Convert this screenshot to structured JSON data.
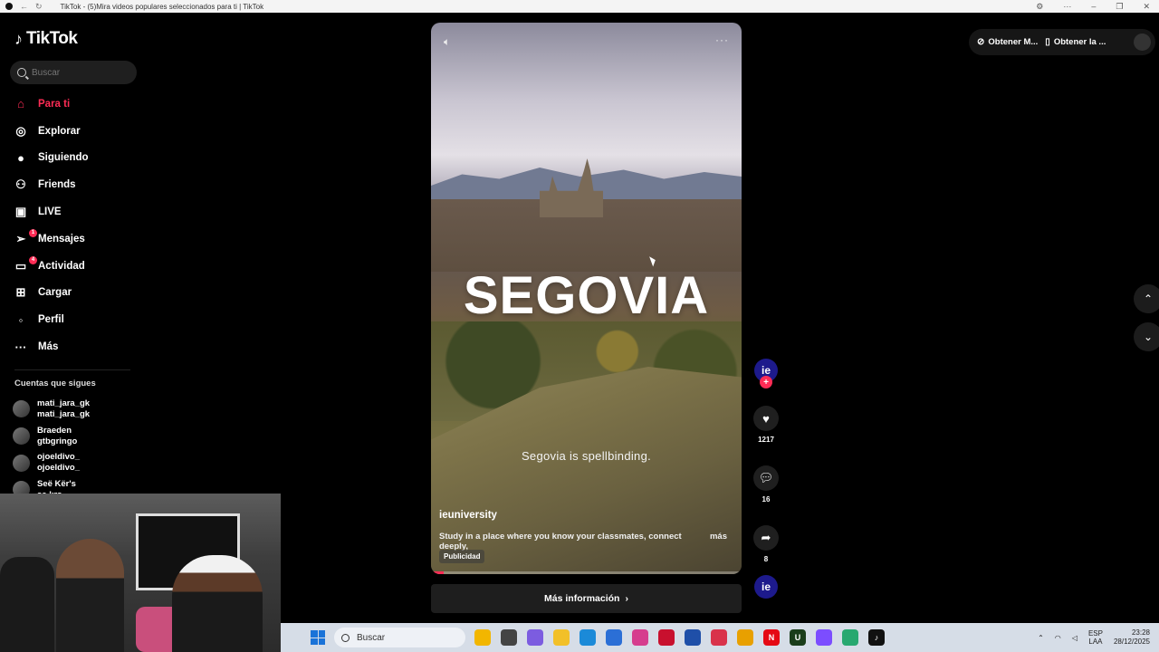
{
  "browser": {
    "tab_title": "TikTok - (5)Mira videos populares seleccionados para ti | TikTok"
  },
  "sidebar": {
    "logo": "TikTok",
    "search_placeholder": "Buscar",
    "items": [
      {
        "label": "Para ti",
        "icon": "home-icon",
        "glyph": "⌂",
        "active": true,
        "badge": ""
      },
      {
        "label": "Explorar",
        "icon": "compass-icon",
        "glyph": "◎",
        "active": false,
        "badge": ""
      },
      {
        "label": "Siguiendo",
        "icon": "following-avatar-icon",
        "glyph": "●",
        "active": false,
        "badge": ""
      },
      {
        "label": "Friends",
        "icon": "friends-icon",
        "glyph": "⚇",
        "active": false,
        "badge": ""
      },
      {
        "label": "LIVE",
        "icon": "live-tv-icon",
        "glyph": "▣",
        "active": false,
        "badge": ""
      },
      {
        "label": "Mensajes",
        "icon": "send-icon",
        "glyph": "➢",
        "active": false,
        "badge": "1"
      },
      {
        "label": "Actividad",
        "icon": "inbox-icon",
        "glyph": "▭",
        "active": false,
        "badge": "4"
      },
      {
        "label": "Cargar",
        "icon": "upload-plus-icon",
        "glyph": "⊞",
        "active": false,
        "badge": ""
      },
      {
        "label": "Perfil",
        "icon": "profile-avatar-icon",
        "glyph": "◦",
        "active": false,
        "badge": ""
      },
      {
        "label": "Más",
        "icon": "more-dots-icon",
        "glyph": "···",
        "active": false,
        "badge": ""
      }
    ],
    "following_title": "Cuentas que sigues",
    "following": [
      {
        "name": "mati_jara_gk",
        "handle": "mati_jara_gk"
      },
      {
        "name": "Braeden",
        "handle": "gtbgringo"
      },
      {
        "name": "ojoeldivo_",
        "handle": "ojoeldivo_"
      },
      {
        "name": "Seë Kër's",
        "handle": "se.krs"
      }
    ]
  },
  "video": {
    "overlay_title": "SEGOVIA",
    "caption": "Segovia is spellbinding.",
    "username": "ieuniversity",
    "description": "Study in a place where you know your classmates, connect deeply,",
    "more_label": "más",
    "ad_label": "Publicidad",
    "progress": 0.04
  },
  "more_info_label": "Más información",
  "actions": {
    "avatar_text": "ie",
    "likes": "1217",
    "comments": "16",
    "shares": "8"
  },
  "top_right": {
    "item1": "Obtener M...",
    "item2": "Obtener la ..."
  },
  "taskbar": {
    "search_placeholder": "Buscar",
    "lang_line1": "ESP",
    "lang_line2": "LAA",
    "time": "23:28",
    "date": "28/12/2025",
    "apps": [
      {
        "name": "file-explorer-icon",
        "color": "#f2b600",
        "text": ""
      },
      {
        "name": "task-view-icon",
        "color": "#444",
        "text": ""
      },
      {
        "name": "copilot-icon",
        "color": "#7c5ce0",
        "text": ""
      },
      {
        "name": "folder-icon",
        "color": "#f2c029",
        "text": ""
      },
      {
        "name": "edge-icon",
        "color": "#1b8ad8",
        "text": ""
      },
      {
        "name": "store-icon",
        "color": "#2b6fd6",
        "text": ""
      },
      {
        "name": "instagram-icon",
        "color": "#d63d8e",
        "text": ""
      },
      {
        "name": "app-red-icon",
        "color": "#c8102e",
        "text": ""
      },
      {
        "name": "shield-app-icon",
        "color": "#1f4fa8",
        "text": ""
      },
      {
        "name": "screen-record-icon",
        "color": "#d9324a",
        "text": ""
      },
      {
        "name": "chrome-icon",
        "color": "#e8a000",
        "text": ""
      },
      {
        "name": "netflix-icon",
        "color": "#e50914",
        "text": "N"
      },
      {
        "name": "upwork-icon",
        "color": "#1a3d1a",
        "text": "U"
      },
      {
        "name": "chrome-alt-icon",
        "color": "#7c4dff",
        "text": ""
      },
      {
        "name": "app-green-icon",
        "color": "#28a870",
        "text": ""
      },
      {
        "name": "tiktok-app-icon",
        "color": "#111",
        "text": "♪"
      }
    ]
  }
}
